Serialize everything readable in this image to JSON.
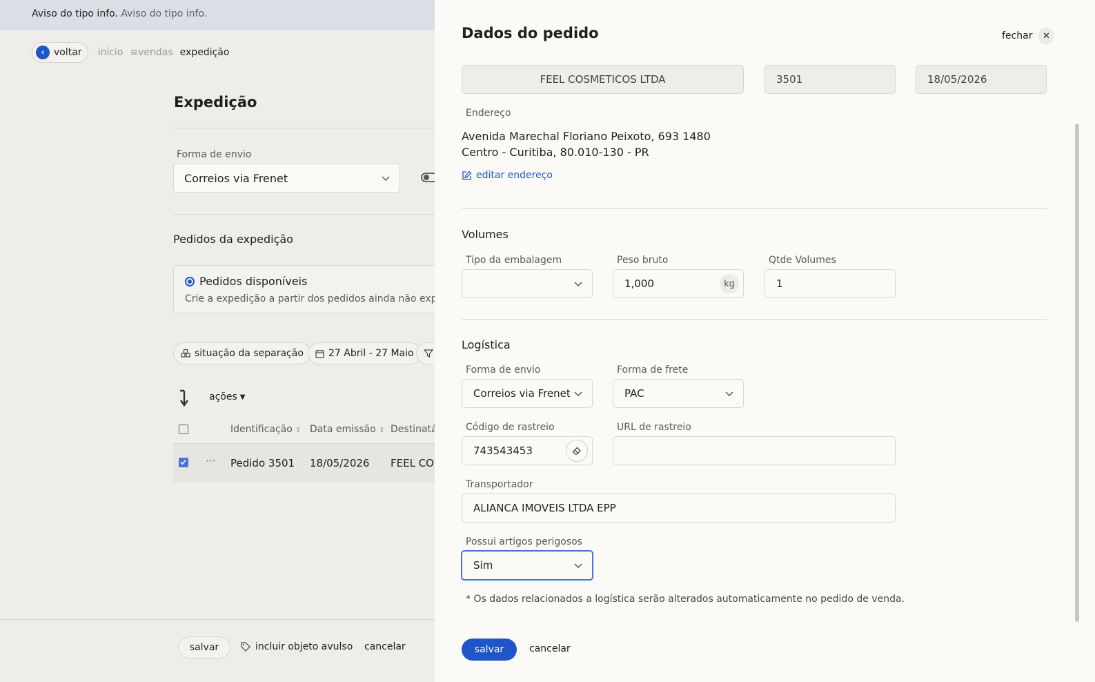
{
  "notice": {
    "strong": "Aviso do tipo info.",
    "muted": "Aviso do tipo info."
  },
  "breadcrumb": {
    "back_label": "voltar",
    "items": [
      "início",
      "vendas",
      "expedição"
    ]
  },
  "page": {
    "title": "Expedição",
    "shipping_label": "Forma de envio",
    "shipping_value": "Correios via Frenet",
    "orders_section": "Pedidos da expedição",
    "card_title": "Pedidos disponíveis",
    "card_desc": "Crie a expedição a partir dos pedidos ainda não expedid",
    "filters": [
      "situação da separação",
      "27 Abril - 27 Maio"
    ],
    "actions_label": "ações",
    "columns": [
      "Identificação",
      "Data emissão",
      "Destinatá"
    ],
    "rows": [
      {
        "id": "Pedido 3501",
        "date": "18/05/2026",
        "recipient": "FEEL CO"
      }
    ],
    "footer": {
      "save": "salvar",
      "include": "incluir objeto avulso",
      "cancel": "cancelar"
    }
  },
  "drawer": {
    "title": "Dados do pedido",
    "close_label": "fechar",
    "header_fields": {
      "recipient_value": "FEEL COSMETICOS LTDA",
      "number_value": "3501",
      "date_value": "18/05/2026"
    },
    "address": {
      "label": "Endereço",
      "line1": "Avenida Marechal Floriano Peixoto, 693 1480",
      "line2": "Centro - Curitiba, 80.010-130 - PR",
      "edit_label": "editar endereço"
    },
    "volumes": {
      "title": "Volumes",
      "package_label": "Tipo da embalagem",
      "package_value": "",
      "weight_label": "Peso bruto",
      "weight_value": "1,000",
      "weight_unit": "kg",
      "qty_label": "Qtde Volumes",
      "qty_value": "1"
    },
    "logistics": {
      "title": "Logística",
      "shipping_label": "Forma de envio",
      "shipping_value": "Correios via Frenet",
      "freight_label": "Forma de frete",
      "freight_value": "PAC",
      "tracking_label": "Código de rastreio",
      "tracking_value": "743543453",
      "tracking_url_label": "URL de rastreio",
      "tracking_url_value": "",
      "carrier_label": "Transportador",
      "carrier_value": "ALIANCA IMOVEIS LTDA EPP",
      "dangerous_label": "Possui artigos perigosos",
      "dangerous_value": "Sim"
    },
    "note": "* Os dados relacionados a logística serão alterados automaticamente no pedido de venda.",
    "save_label": "salvar",
    "cancel_label": "cancelar"
  },
  "colors": {
    "primary": "#1f55c8",
    "drawer_bg": "#fbfaf7",
    "page_bg": "#eeede9",
    "notice_bg": "#d9dfe5"
  }
}
